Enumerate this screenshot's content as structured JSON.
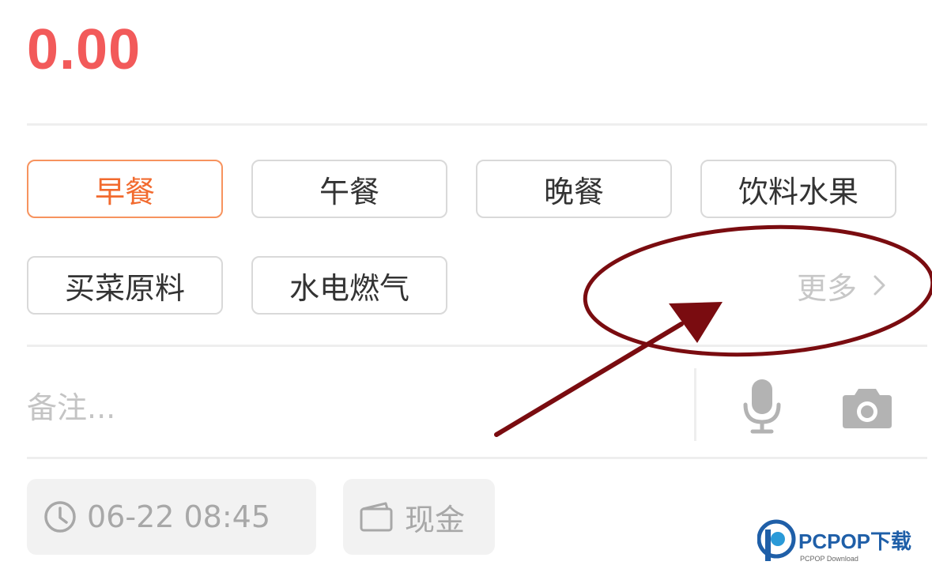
{
  "amount": {
    "value": "0.00"
  },
  "categories": {
    "row1": [
      "早餐",
      "午餐",
      "晚餐",
      "饮料水果"
    ],
    "row2": [
      "买菜原料",
      "水电燃气"
    ],
    "selected": "早餐",
    "more_label": "更多"
  },
  "note": {
    "placeholder": "备注..."
  },
  "footer": {
    "datetime": "06-22 08:45",
    "payment_method": "现金"
  },
  "watermark": {
    "brand": "PCPOP下载",
    "sub": "PCPOP Download"
  },
  "icons": {
    "chevron": "chevron-right-icon",
    "mic": "microphone-icon",
    "camera": "camera-icon",
    "clock": "clock-icon",
    "wallet": "wallet-icon",
    "annotation": "red-ellipse-and-arrow"
  },
  "colors": {
    "amount": "#f25a5a",
    "selected_border": "#f7935e",
    "selected_text": "#f26a2e",
    "annotation": "#7a0c10",
    "watermark_blue": "#1f5fa8"
  }
}
